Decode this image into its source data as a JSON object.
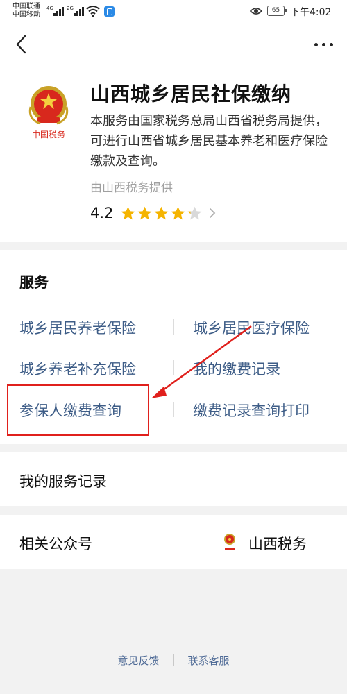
{
  "status_bar": {
    "carrier1": "中国联通",
    "carrier2": "中国移动",
    "net1": "4G",
    "net2": "2G",
    "battery": "65",
    "time": "下午4:02"
  },
  "app": {
    "title": "山西城乡居民社保缴纳",
    "logo_text": "中国税务",
    "description": "本服务由国家税务总局山西省税务局提供，可进行山西省城乡居民基本养老和医疗保险缴款及查询。",
    "provider": "由山西税务提供",
    "rating": "4.2",
    "rating_value": 4.2
  },
  "services": {
    "title": "服务",
    "items": [
      {
        "label": "城乡居民养老保险"
      },
      {
        "label": "城乡居民医疗保险"
      },
      {
        "label": "城乡养老补充保险"
      },
      {
        "label": "我的缴费记录"
      },
      {
        "label": "参保人缴费查询"
      },
      {
        "label": "缴费记录查询打印"
      }
    ],
    "link_color": "#3e5d87",
    "highlight_color": "#e0201c"
  },
  "records": {
    "label": "我的服务记录"
  },
  "accounts": {
    "label": "相关公众号",
    "name": "山西税务"
  },
  "footer": {
    "feedback": "意见反馈",
    "contact": "联系客服"
  }
}
